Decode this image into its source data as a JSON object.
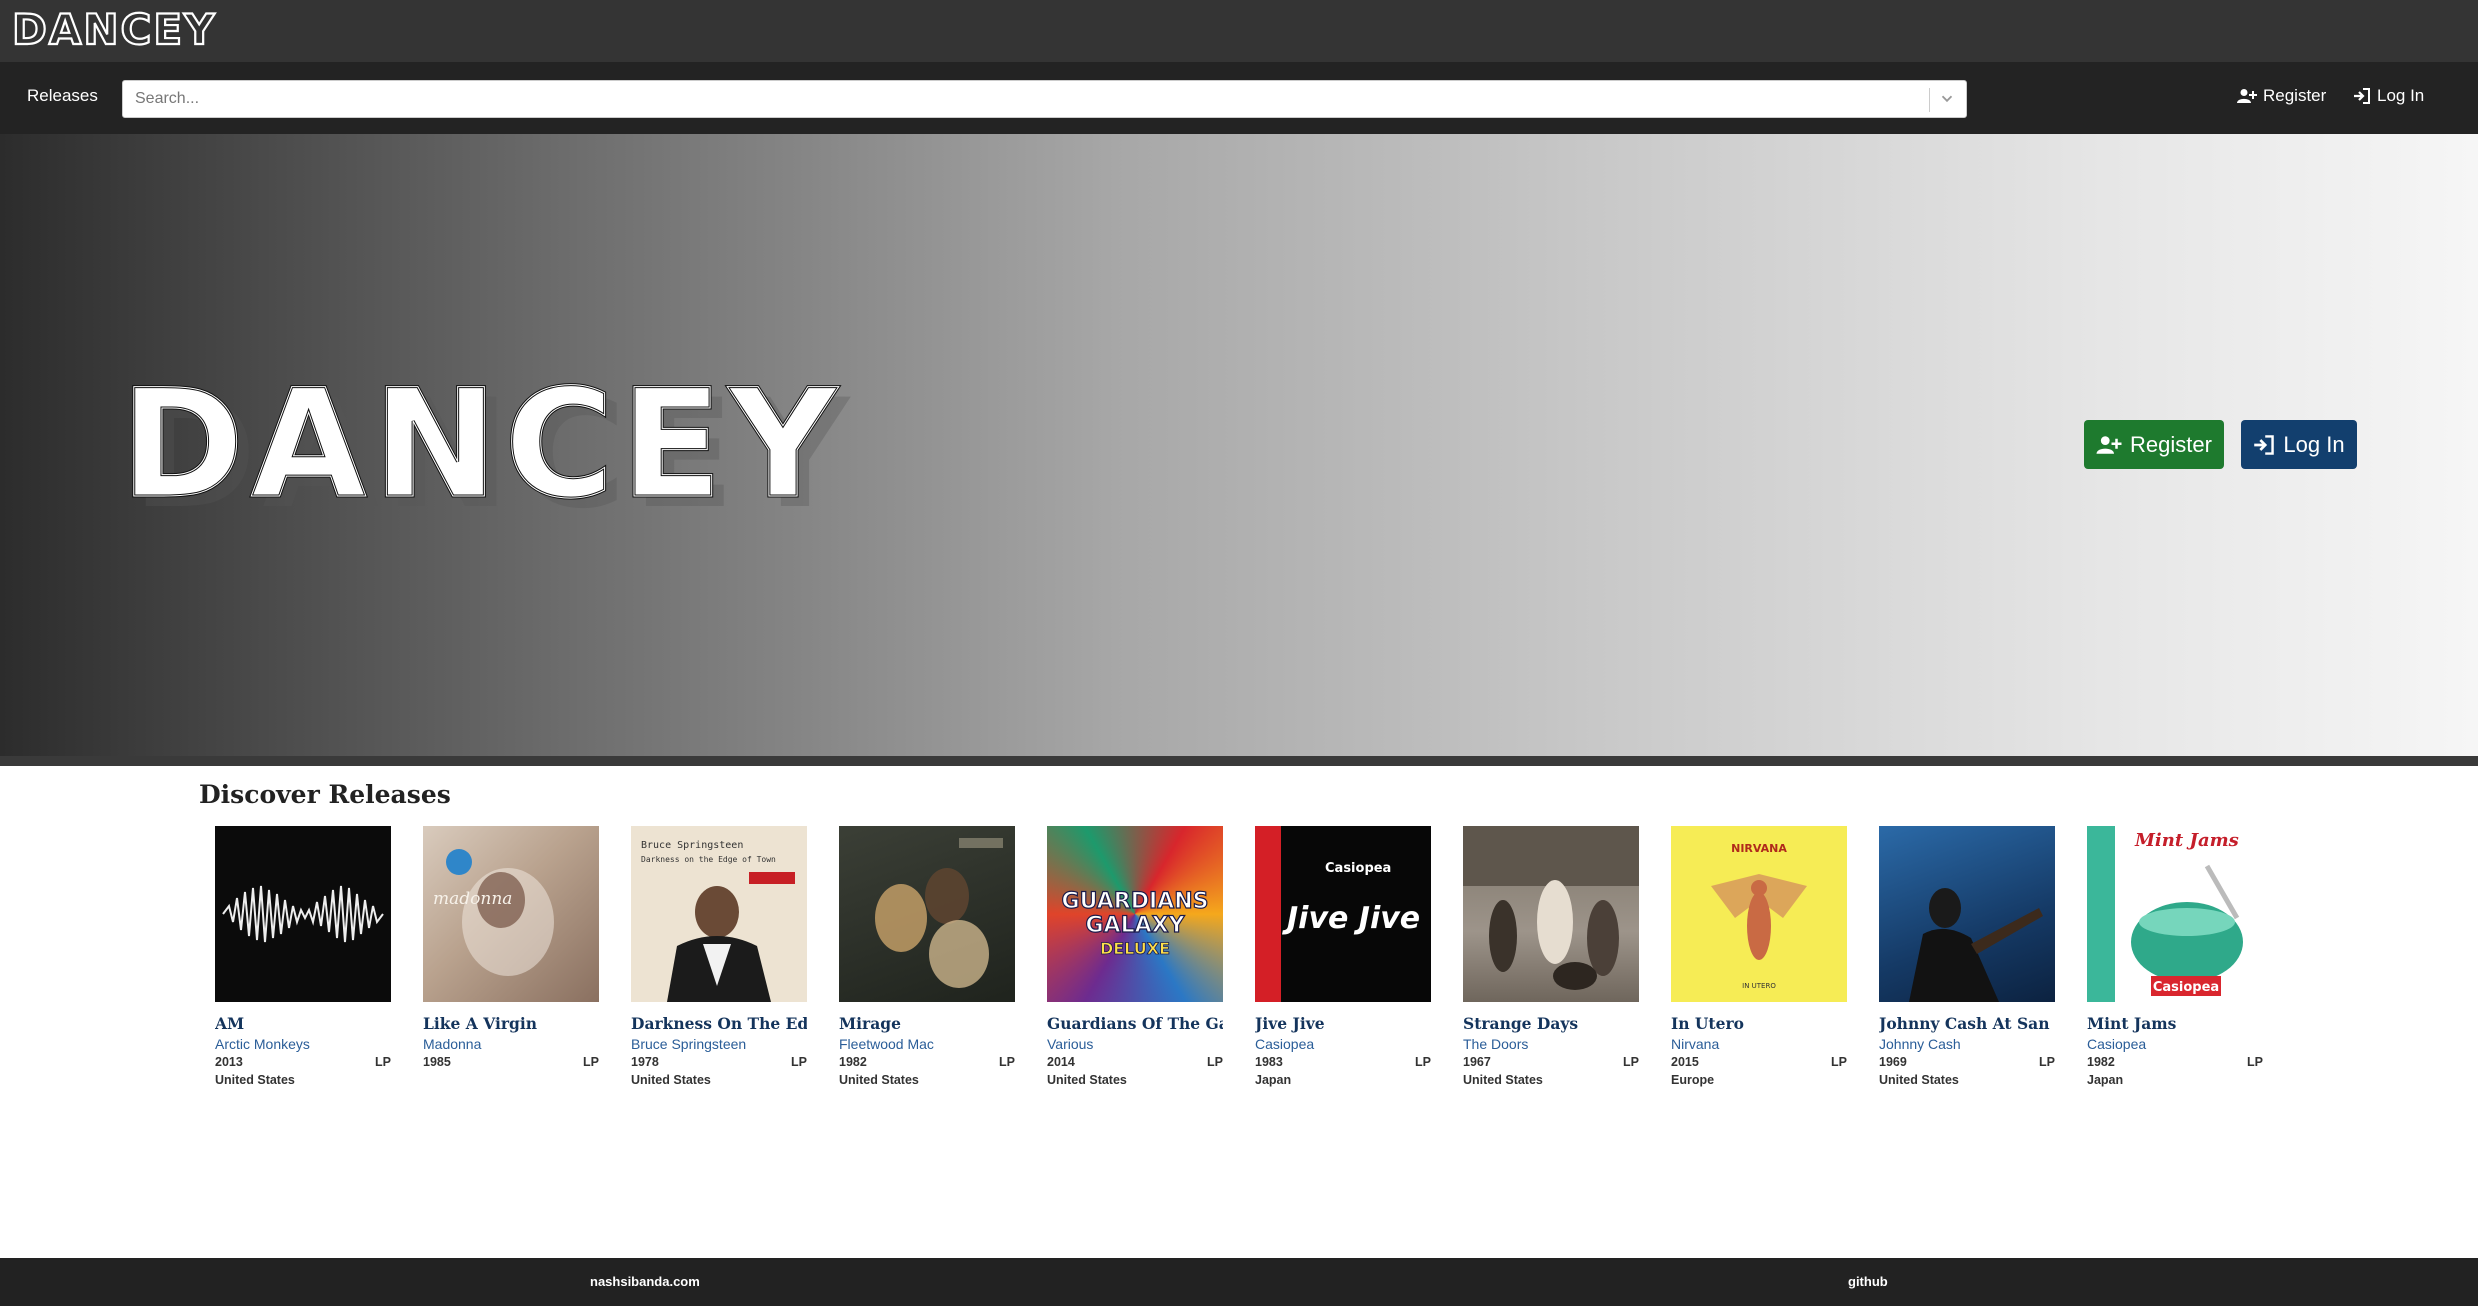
{
  "brand": {
    "name": "DANCEY"
  },
  "nav": {
    "releases_label": "Releases",
    "search_placeholder": "Search...",
    "register_label": "Register",
    "login_label": "Log In"
  },
  "hero": {
    "logo_text": "DANCEY",
    "register_label": "Register",
    "login_label": "Log In"
  },
  "discover": {
    "title": "Discover Releases",
    "releases": [
      {
        "title": "AM",
        "artist": "Arctic Monkeys",
        "year": "2013",
        "format": "LP",
        "country": "United States"
      },
      {
        "title": "Like A Virgin",
        "artist": "Madonna",
        "year": "1985",
        "format": "LP",
        "country": ""
      },
      {
        "title": "Darkness On The Edg...",
        "artist": "Bruce Springsteen",
        "year": "1978",
        "format": "LP",
        "country": "United States"
      },
      {
        "title": "Mirage",
        "artist": "Fleetwood Mac",
        "year": "1982",
        "format": "LP",
        "country": "United States"
      },
      {
        "title": "Guardians Of The Gal...",
        "artist": "Various",
        "year": "2014",
        "format": "LP",
        "country": "United States"
      },
      {
        "title": "Jive Jive",
        "artist": "Casiopea",
        "year": "1983",
        "format": "LP",
        "country": "Japan"
      },
      {
        "title": "Strange Days",
        "artist": "The Doors",
        "year": "1967",
        "format": "LP",
        "country": "United States"
      },
      {
        "title": "In Utero",
        "artist": "Nirvana",
        "year": "2015",
        "format": "LP",
        "country": "Europe"
      },
      {
        "title": "Johnny Cash At San Q...",
        "artist": "Johnny Cash",
        "year": "1969",
        "format": "LP",
        "country": "United States"
      },
      {
        "title": "Mint Jams",
        "artist": "Casiopea",
        "year": "1982",
        "format": "LP",
        "country": "Japan"
      }
    ],
    "cover_text": {
      "madonna": "madonna",
      "bruce": "Bruce Springsteen",
      "bruce_sub": "Darkness on the Edge of Town",
      "guardians": "GUARDIANS",
      "galaxy": "GALAXY",
      "deluxe": "DELUXE",
      "casiopea": "Casiopea",
      "jive": "Jive Jive",
      "nirvana": "NIRVANA",
      "inutero": "IN UTERO",
      "mint": "Mint Jams",
      "mint_band": "Casiopea"
    }
  },
  "footer": {
    "site_label": "nashsibanda.com",
    "github_label": "github"
  },
  "colors": {
    "brandbar": "#343434",
    "navbar": "#232323",
    "register_green": "#1e7a2e",
    "login_blue": "#123f6e",
    "release_title": "#14345c",
    "release_artist": "#2a5d98"
  }
}
